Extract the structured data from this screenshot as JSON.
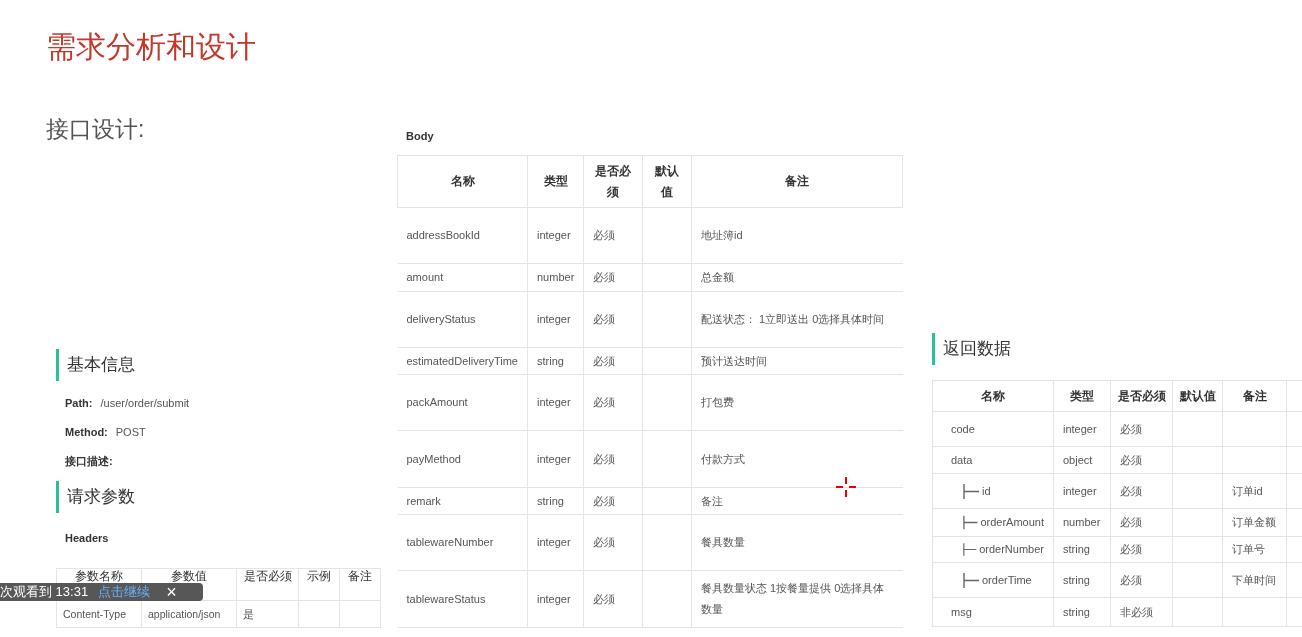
{
  "slide": {
    "title": "需求分析和设计",
    "subtitle": "接口设计:"
  },
  "basic_info": {
    "heading": "基本信息",
    "fields": [
      {
        "label": "Path:",
        "value": "/user/order/submit"
      },
      {
        "label": "Method:",
        "value": "POST"
      },
      {
        "label": "接口描述:"
      }
    ]
  },
  "request_params": {
    "heading": "请求参数",
    "headers_label": "Headers",
    "columns": [
      "参数名称",
      "参数值",
      "是否必须",
      "示例",
      "备注"
    ],
    "rows": [
      {
        "name": "Content-Type",
        "value": "application/json",
        "required": "是"
      }
    ]
  },
  "body": {
    "label": "Body",
    "columns": [
      "名称",
      "类型",
      "是否必须",
      "默认值",
      "备注"
    ],
    "rows": [
      {
        "name": "addressBookId",
        "type": "integer",
        "required": "必须",
        "note": "地址簿id"
      },
      {
        "name": "amount",
        "type": "number",
        "required": "必须",
        "note": "总金额"
      },
      {
        "name": "deliveryStatus",
        "type": "integer",
        "required": "必须",
        "note": "配送状态： 1立即送出 0选择具体时间"
      },
      {
        "name": "estimatedDeliveryTime",
        "type": "string",
        "required": "必须",
        "note": "预计送达时间"
      },
      {
        "name": "packAmount",
        "type": "integer",
        "required": "必须",
        "note": "打包费"
      },
      {
        "name": "payMethod",
        "type": "integer",
        "required": "必须",
        "note": "付款方式"
      },
      {
        "name": "remark",
        "type": "string",
        "required": "必须",
        "note": "备注"
      },
      {
        "name": "tablewareNumber",
        "type": "integer",
        "required": "必须",
        "note": "餐具数量"
      },
      {
        "name": "tablewareStatus",
        "type": "integer",
        "required": "必须",
        "note": "餐具数量状态 1按餐量提供 0选择具体数量"
      }
    ]
  },
  "response": {
    "heading": "返回数据",
    "columns": [
      "名称",
      "类型",
      "是否必须",
      "默认值",
      "备注"
    ],
    "rows": [
      {
        "name": "code",
        "type": "integer",
        "required": "必须"
      },
      {
        "name": "data",
        "type": "object",
        "required": "必须",
        "children": [
          {
            "name": "id",
            "type": "integer",
            "required": "必须",
            "note": "订单id"
          },
          {
            "name": "orderAmount",
            "type": "number",
            "required": "必须",
            "note": "订单金额"
          },
          {
            "name": "orderNumber",
            "type": "string",
            "required": "必须",
            "note": "订单号"
          },
          {
            "name": "orderTime",
            "type": "string",
            "required": "必须",
            "note": "下单时间"
          }
        ]
      },
      {
        "name": "msg",
        "type": "string",
        "required": "非必须"
      }
    ]
  },
  "resume_toast": {
    "text": "次观看到 13:31",
    "link": "点击继续",
    "close": "×"
  }
}
